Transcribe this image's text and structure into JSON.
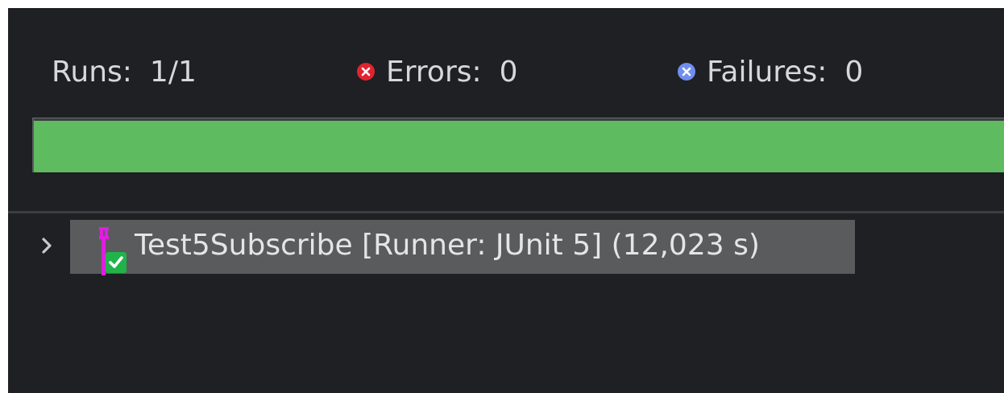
{
  "counters": {
    "runs_label": "Runs:",
    "runs_value": "1/1",
    "errors_label": "Errors:",
    "errors_value": "0",
    "failures_label": "Failures:",
    "failures_value": "0"
  },
  "progress": {
    "fraction": 1.0,
    "status_color": "#5fbb5f"
  },
  "tree": {
    "items": [
      {
        "label": "Test5Subscribe [Runner: JUnit 5] (12,023 s)",
        "icon": "test-suite-passed-icon",
        "expanded": false
      }
    ]
  },
  "colors": {
    "background": "#1e2023",
    "error": "#e0242f",
    "failure": "#6f8ef0",
    "selection": "#5a5b5d",
    "passed": "#21b34a"
  }
}
